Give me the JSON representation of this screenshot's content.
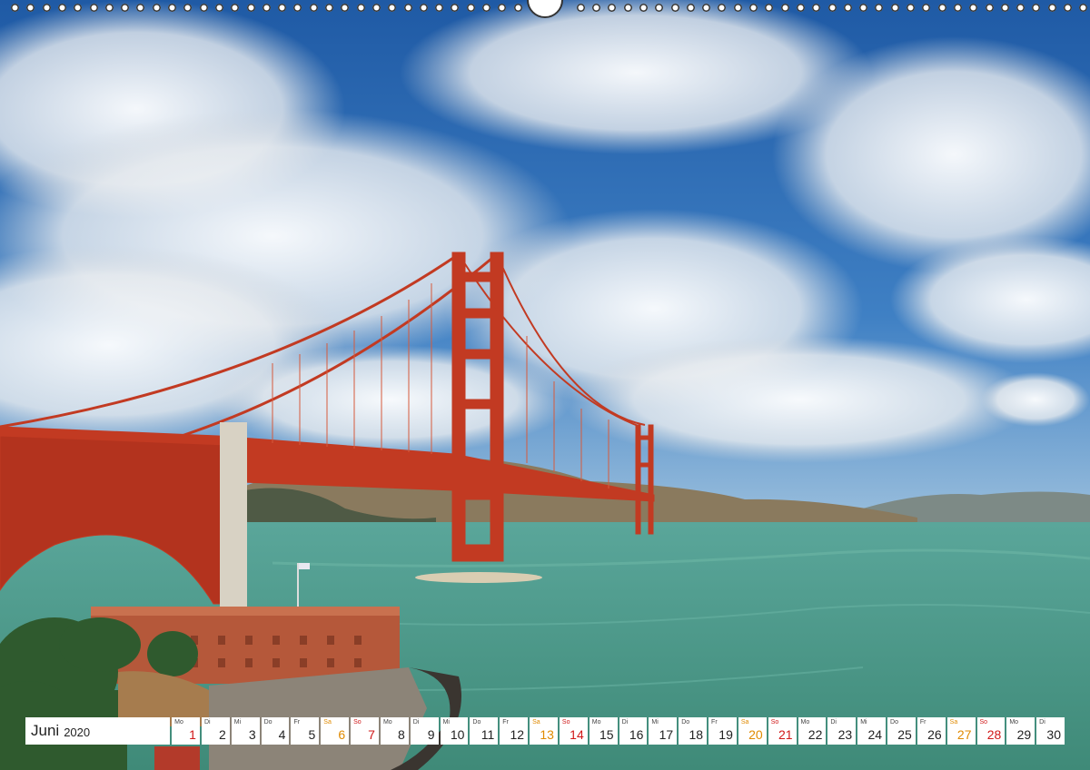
{
  "calendar": {
    "month": "Juni",
    "year": "2020",
    "days": [
      {
        "dow": "Mo",
        "num": "1",
        "type": "hol"
      },
      {
        "dow": "Di",
        "num": "2",
        "type": ""
      },
      {
        "dow": "Mi",
        "num": "3",
        "type": ""
      },
      {
        "dow": "Do",
        "num": "4",
        "type": ""
      },
      {
        "dow": "Fr",
        "num": "5",
        "type": ""
      },
      {
        "dow": "Sa",
        "num": "6",
        "type": "sat"
      },
      {
        "dow": "So",
        "num": "7",
        "type": "sun"
      },
      {
        "dow": "Mo",
        "num": "8",
        "type": ""
      },
      {
        "dow": "Di",
        "num": "9",
        "type": ""
      },
      {
        "dow": "Mi",
        "num": "10",
        "type": ""
      },
      {
        "dow": "Do",
        "num": "11",
        "type": ""
      },
      {
        "dow": "Fr",
        "num": "12",
        "type": ""
      },
      {
        "dow": "Sa",
        "num": "13",
        "type": "sat"
      },
      {
        "dow": "So",
        "num": "14",
        "type": "sun"
      },
      {
        "dow": "Mo",
        "num": "15",
        "type": ""
      },
      {
        "dow": "Di",
        "num": "16",
        "type": ""
      },
      {
        "dow": "Mi",
        "num": "17",
        "type": ""
      },
      {
        "dow": "Do",
        "num": "18",
        "type": ""
      },
      {
        "dow": "Fr",
        "num": "19",
        "type": ""
      },
      {
        "dow": "Sa",
        "num": "20",
        "type": "sat"
      },
      {
        "dow": "So",
        "num": "21",
        "type": "sun"
      },
      {
        "dow": "Mo",
        "num": "22",
        "type": ""
      },
      {
        "dow": "Di",
        "num": "23",
        "type": ""
      },
      {
        "dow": "Mi",
        "num": "24",
        "type": ""
      },
      {
        "dow": "Do",
        "num": "25",
        "type": ""
      },
      {
        "dow": "Fr",
        "num": "26",
        "type": ""
      },
      {
        "dow": "Sa",
        "num": "27",
        "type": "sat"
      },
      {
        "dow": "So",
        "num": "28",
        "type": "sun"
      },
      {
        "dow": "Mo",
        "num": "29",
        "type": ""
      },
      {
        "dow": "Di",
        "num": "30",
        "type": ""
      }
    ]
  },
  "colors": {
    "bridge": "#c23a22",
    "sky": "#2f6fb4",
    "water": "#4f9a8a",
    "saturday": "#e08a00",
    "sunday": "#d01818"
  }
}
